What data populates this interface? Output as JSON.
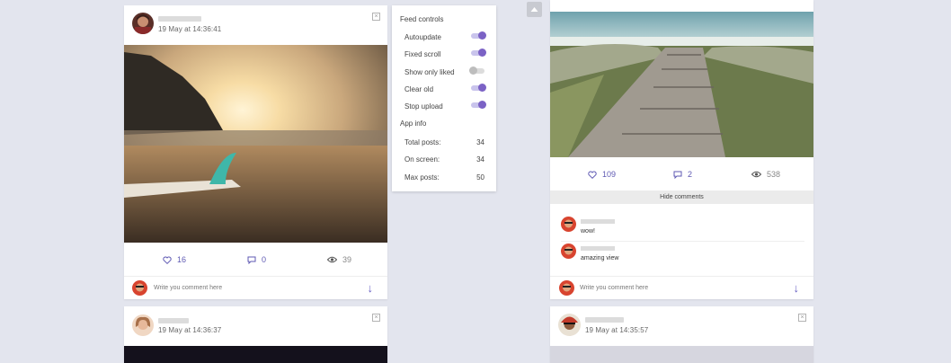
{
  "posts": [
    {
      "date": "19 May at 14:36:41",
      "likes": "16",
      "comments": "0",
      "views": "39",
      "comment_placeholder": "Write you comment here",
      "send_icon": "arrow-down-icon"
    },
    {
      "date": "19 May at 14:36:37"
    },
    {
      "likes": "109",
      "comments": "2",
      "views": "538",
      "hide_comments_label": "Hide comments",
      "comment_list": [
        {
          "text": "wow!"
        },
        {
          "text": "amazing view"
        }
      ],
      "comment_placeholder": "Write you comment here"
    },
    {
      "date": "19 May at 14:35:57"
    }
  ],
  "feed_controls": {
    "title": "Feed controls",
    "toggles": [
      {
        "label": "Autoupdate",
        "on": true
      },
      {
        "label": "Fixed scroll",
        "on": true
      },
      {
        "label": "Show only liked",
        "on": false
      },
      {
        "label": "Clear old",
        "on": true
      },
      {
        "label": "Stop upload",
        "on": true
      }
    ]
  },
  "app_info": {
    "title": "App info",
    "rows": [
      {
        "label": "Total posts:",
        "value": "34"
      },
      {
        "label": "On screen:",
        "value": "34"
      },
      {
        "label": "Max posts:",
        "value": "50"
      }
    ]
  },
  "colors": {
    "accent": "#6a62c4",
    "background": "#e3e5ee"
  }
}
